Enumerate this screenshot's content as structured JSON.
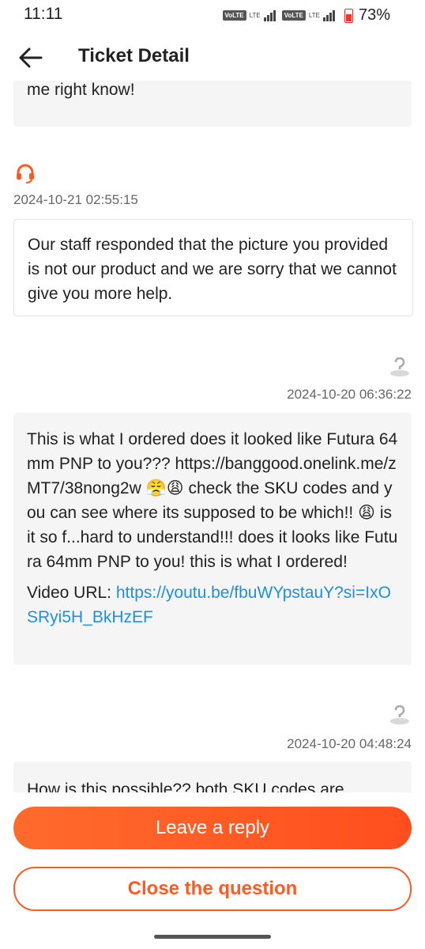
{
  "status": {
    "time": "11:11",
    "battery": "73%",
    "volte1": "VoLTE",
    "lte1": "LTE",
    "volte2": "VoLTE",
    "lte2": "LTE"
  },
  "header": {
    "title": "Ticket Detail"
  },
  "messages": [
    {
      "text": "me right know!"
    },
    {
      "timestamp": "2024-10-21 02:55:15",
      "text": "Our staff responded that the picture you provided is not our product and we are sorry that we cannot give you more help."
    },
    {
      "timestamp": "2024-10-20 06:36:22",
      "text": "This is what I ordered does it looked like Futura 64mm PNP to you??? https://banggood.onelink.me/zMT7/38nong2w 😤😩 check the SKU codes and you can see where its supposed to be which!! 😩 is it so f...hard to understand!!! does it looks like Futura 64mm PNP to you! this is what I ordered!",
      "video_label": "Video URL: ",
      "video_url": "https://youtu.be/fbuWYpstauY?si=IxOSRyi5H_BkHzEF"
    },
    {
      "timestamp": "2024-10-20 04:48:24",
      "text": "How is this possible?? both SKU codes are"
    }
  ],
  "buttons": {
    "reply": "Leave a reply",
    "close": "Close the question"
  },
  "colors": {
    "accent": "#ff5a22",
    "link": "#1e8fe1"
  },
  "icons": {
    "agent": "headset-icon",
    "user": "user-avatar-icon",
    "back": "back-arrow-icon"
  }
}
